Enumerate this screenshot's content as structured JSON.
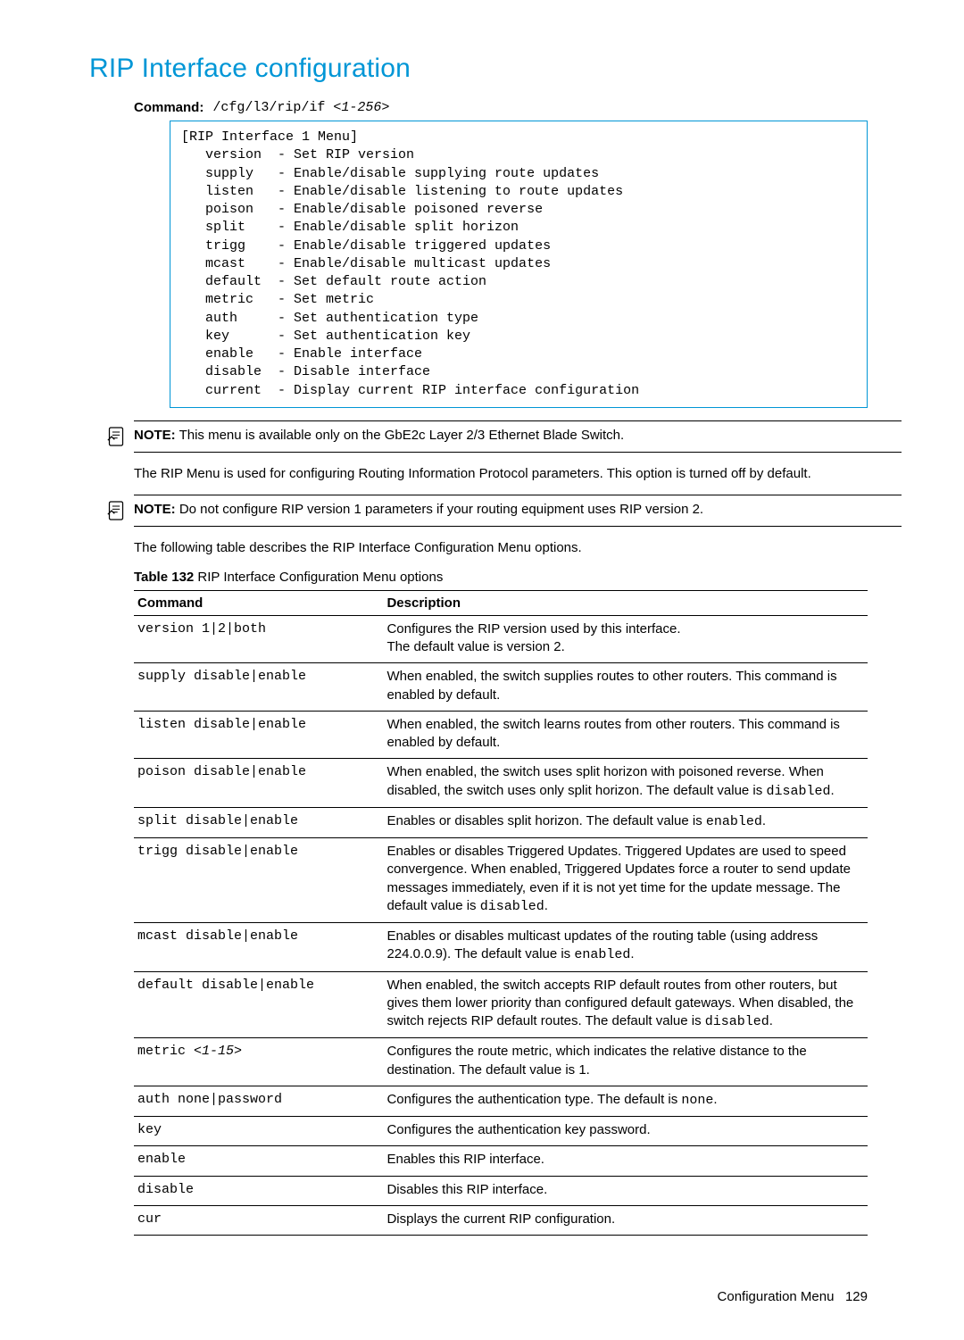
{
  "title": "RIP Interface configuration",
  "command": {
    "label": "Command:",
    "path": "/cfg/l3/rip/if ",
    "arg": "<1-256>"
  },
  "menu_box": "[RIP Interface 1 Menu]\n   version  - Set RIP version\n   supply   - Enable/disable supplying route updates\n   listen   - Enable/disable listening to route updates\n   poison   - Enable/disable poisoned reverse\n   split    - Enable/disable split horizon\n   trigg    - Enable/disable triggered updates\n   mcast    - Enable/disable multicast updates\n   default  - Set default route action\n   metric   - Set metric\n   auth     - Set authentication type\n   key      - Set authentication key\n   enable   - Enable interface\n   disable  - Disable interface\n   current  - Display current RIP interface configuration",
  "notes": {
    "label": "NOTE:",
    "note1": "This menu is available only on the GbE2c Layer 2/3 Ethernet Blade Switch.",
    "note2": "Do not configure RIP version 1 parameters if your routing equipment uses RIP version 2."
  },
  "paras": {
    "p1": "The RIP Menu is used for configuring Routing Information Protocol parameters. This option is turned off by default.",
    "p2": "The following table describes the RIP Interface Configuration Menu options."
  },
  "table": {
    "caption_bold": "Table 132",
    "caption_rest": " RIP Interface Configuration Menu options",
    "headers": {
      "cmd": "Command",
      "desc": "Description"
    },
    "rows": [
      {
        "cmd": "version 1|2|both",
        "desc": [
          {
            "t": "Configures the RIP version used by this interface."
          },
          {
            "br": true
          },
          {
            "t": "The default value is version 2."
          }
        ]
      },
      {
        "cmd": "supply disable|enable",
        "desc": [
          {
            "t": "When enabled, the switch supplies routes to other routers. This command is enabled by default."
          }
        ]
      },
      {
        "cmd": "listen disable|enable",
        "desc": [
          {
            "t": "When enabled, the switch learns routes from other routers. This command is enabled by default."
          }
        ]
      },
      {
        "cmd": "poison disable|enable",
        "desc": [
          {
            "t": "When enabled, the switch uses split horizon with poisoned reverse. When disabled, the switch uses only split horizon. The default value is "
          },
          {
            "m": "disabled"
          },
          {
            "t": "."
          }
        ]
      },
      {
        "cmd": "split disable|enable",
        "desc": [
          {
            "t": "Enables or disables split horizon. The default value is "
          },
          {
            "m": "enabled"
          },
          {
            "t": "."
          }
        ]
      },
      {
        "cmd": "trigg disable|enable",
        "desc": [
          {
            "t": "Enables or disables Triggered Updates. Triggered Updates are used to speed convergence. When enabled, Triggered Updates force a router to send update messages immediately, even if it is not yet time for the update message. The default value is "
          },
          {
            "m": "disabled"
          },
          {
            "t": "."
          }
        ]
      },
      {
        "cmd": "mcast disable|enable",
        "desc": [
          {
            "t": "Enables or disables multicast updates of the routing table (using address 224.0.0.9). The default value is "
          },
          {
            "m": "enabled"
          },
          {
            "t": "."
          }
        ]
      },
      {
        "cmd": "default disable|enable",
        "desc": [
          {
            "t": "When enabled, the switch accepts RIP default routes from other routers, but gives them lower priority than configured default gateways. When disabled, the switch rejects RIP default routes. The default value is "
          },
          {
            "m": "disabled"
          },
          {
            "t": "."
          }
        ]
      },
      {
        "cmd": "metric <1-15>",
        "cmd_parts": [
          {
            "t": "metric "
          },
          {
            "i": "<1-15>"
          }
        ],
        "desc": [
          {
            "t": "Configures the route metric, which indicates the relative distance to the destination. The default value is 1."
          }
        ]
      },
      {
        "cmd": "auth none|password",
        "desc": [
          {
            "t": "Configures the authentication type. The default is "
          },
          {
            "m": "none"
          },
          {
            "t": "."
          }
        ]
      },
      {
        "cmd": "key",
        "desc": [
          {
            "t": "Configures the authentication key password."
          }
        ]
      },
      {
        "cmd": "enable",
        "desc": [
          {
            "t": "Enables this RIP interface."
          }
        ]
      },
      {
        "cmd": "disable",
        "desc": [
          {
            "t": "Disables this RIP interface."
          }
        ]
      },
      {
        "cmd": "cur",
        "desc": [
          {
            "t": "Displays the current RIP configuration."
          }
        ]
      }
    ]
  },
  "footer": {
    "section": "Configuration Menu",
    "page": "129"
  }
}
